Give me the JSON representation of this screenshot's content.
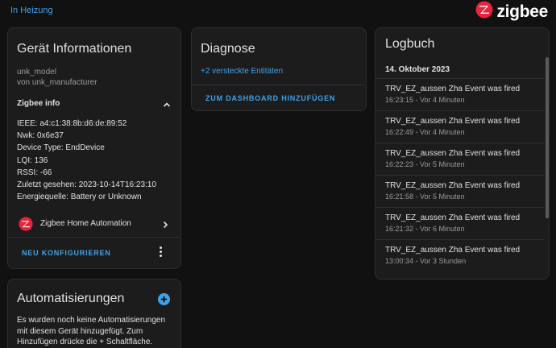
{
  "breadcrumb": "In Heizung",
  "brand": {
    "name": "zigbee",
    "logo_icon": "zigbee-logo-icon",
    "accent_color": "#e8233b"
  },
  "device_info": {
    "title": "Gerät Informationen",
    "model": "unk_model",
    "manufacturer": "von unk_manufacturer",
    "zigbee_info_label": "Zigbee info",
    "lines": [
      "IEEE: a4:c1:38:8b:d6:de:89:52",
      "Nwk: 0x6e37",
      "Device Type: EndDevice",
      "LQI: 136",
      "RSSI: -66",
      "Zuletzt gesehen: 2023-10-14T16:23:10",
      "Energiequelle: Battery or Unknown"
    ],
    "integration_label": "Zigbee Home Automation",
    "reconfigure_label": "NEU KONFIGURIEREN"
  },
  "diagnose": {
    "title": "Diagnose",
    "hidden_entities": "+2 versteckte Entitäten",
    "add_dashboard_label": "ZUM DASHBOARD HINZUFÜGEN"
  },
  "logbook": {
    "title": "Logbuch",
    "date": "14. Oktober 2023",
    "entries": [
      {
        "title": "TRV_EZ_aussen Zha Event was fired",
        "time": "16:23:15 - Vor 4 Minuten"
      },
      {
        "title": "TRV_EZ_aussen Zha Event was fired",
        "time": "16:22:49 - Vor 4 Minuten"
      },
      {
        "title": "TRV_EZ_aussen Zha Event was fired",
        "time": "16:22:23 - Vor 5 Minuten"
      },
      {
        "title": "TRV_EZ_aussen Zha Event was fired",
        "time": "16:21:58 - Vor 5 Minuten"
      },
      {
        "title": "TRV_EZ_aussen Zha Event was fired",
        "time": "16:21:32 - Vor 6 Minuten"
      },
      {
        "title": "TRV_EZ_aussen Zha Event was fired",
        "time": "13:00:34 - Vor 3 Stunden"
      }
    ]
  },
  "automations": {
    "title": "Automatisierungen",
    "empty_text": "Es wurden noch keine Automatisierungen mit diesem Gerät hinzugefügt. Zum Hinzufügen drücke die + Schaltfläche."
  },
  "colors": {
    "link": "#3fa3ec",
    "card_bg": "#1c1c1c",
    "page_bg": "#111111"
  }
}
